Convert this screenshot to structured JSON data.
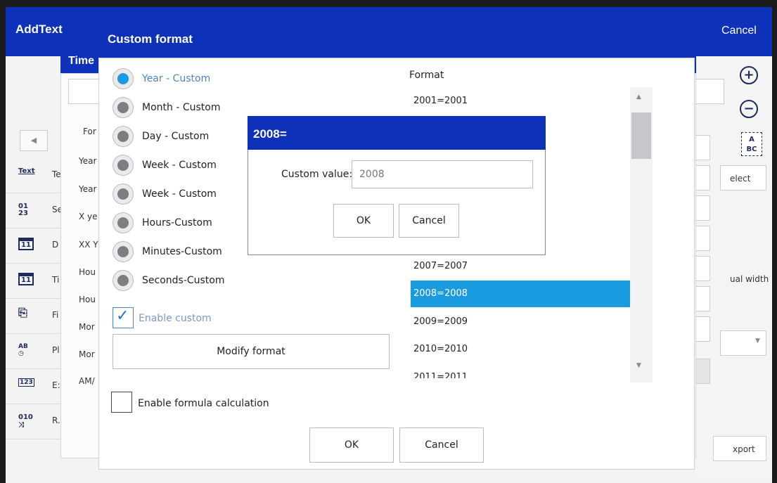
{
  "app": {
    "title": "AddText",
    "cancel": "Cancel"
  },
  "sidebar": {
    "items": [
      {
        "icon": "text-icon",
        "glyph": "Text",
        "label": "Te"
      },
      {
        "icon": "serial-number-icon",
        "glyph": "01\n23",
        "label": "Se"
      },
      {
        "icon": "date-calendar-icon",
        "glyph": "11",
        "label": "D"
      },
      {
        "icon": "time-calendar-icon",
        "glyph": "11",
        "label": "Ti"
      },
      {
        "icon": "file-icon",
        "glyph": "⎘",
        "label": "Fi"
      },
      {
        "icon": "plan-icon",
        "glyph": "AB",
        "label": "Pl"
      },
      {
        "icon": "expression-icon",
        "glyph": "123",
        "label": "E:"
      },
      {
        "icon": "random-icon",
        "glyph": "010",
        "label": "R."
      }
    ]
  },
  "time_dialog": {
    "title": "Time",
    "format_label": "For",
    "rows": [
      "Year",
      "Year",
      "X ye",
      "XX Y",
      "Hou",
      "Hou",
      "Mor",
      "Mor",
      "AM/"
    ]
  },
  "right_panel": {
    "select_label": "elect",
    "ual_width_label": "ual width",
    "export_label": "xport"
  },
  "custom_format": {
    "title": "Custom format",
    "options": [
      {
        "label": "Year - Custom",
        "selected": true
      },
      {
        "label": "Month - Custom",
        "selected": false
      },
      {
        "label": "Day - Custom",
        "selected": false
      },
      {
        "label": "Week - Custom",
        "selected": false
      },
      {
        "label": "Week - Custom",
        "selected": false
      },
      {
        "label": "Hours-Custom",
        "selected": false
      },
      {
        "label": "Minutes-Custom",
        "selected": false
      },
      {
        "label": "Seconds-Custom",
        "selected": false
      }
    ],
    "enable_custom_label": "Enable custom",
    "enable_custom_checked": true,
    "modify_format_label": "Modify format",
    "enable_formula_label": "Enable formula calculation",
    "enable_formula_checked": false,
    "format_heading": "Format",
    "format_items": [
      {
        "label": "2001=2001",
        "selected": false
      },
      {
        "label": "2007=2007",
        "selected": false
      },
      {
        "label": "2008=2008",
        "selected": true
      },
      {
        "label": "2009=2009",
        "selected": false
      },
      {
        "label": "2010=2010",
        "selected": false
      },
      {
        "label": "2011=2011",
        "selected": false
      }
    ],
    "ok_label": "OK",
    "cancel_label": "Cancel"
  },
  "popup": {
    "title": "2008=",
    "custom_value_label": "Custom value:",
    "custom_value": "2008",
    "ok_label": "OK",
    "cancel_label": "Cancel"
  },
  "colors": {
    "header_blue": "#0d31b8",
    "selection_blue": "#1a9be0"
  }
}
